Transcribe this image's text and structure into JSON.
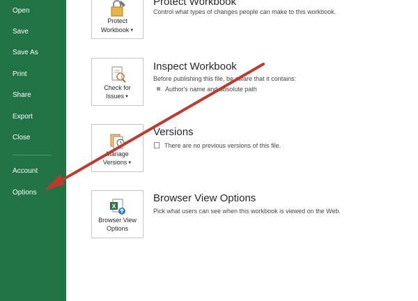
{
  "sidebar": {
    "items": [
      {
        "label": "Open"
      },
      {
        "label": "Save"
      },
      {
        "label": "Save As"
      },
      {
        "label": "Print"
      },
      {
        "label": "Share"
      },
      {
        "label": "Export"
      },
      {
        "label": "Close"
      },
      {
        "label": "Account"
      },
      {
        "label": "Options"
      }
    ]
  },
  "sections": {
    "protect": {
      "button_line1": "Protect",
      "button_line2": "Workbook",
      "title": "Protect Workbook",
      "description": "Control what types of changes people can make to this workbook."
    },
    "inspect": {
      "button_line1": "Check for",
      "button_line2": "Issues",
      "title": "Inspect Workbook",
      "description": "Before publishing this file, be aware that it contains:",
      "bullet": "Author's name and absolute path"
    },
    "versions": {
      "button_line1": "Manage",
      "button_line2": "Versions",
      "title": "Versions",
      "description": "There are no previous versions of this file."
    },
    "browser": {
      "button_line1": "Browser View",
      "button_line2": "Options",
      "title": "Browser View Options",
      "description": "Pick what users can see when this workbook is viewed on the Web."
    }
  },
  "colors": {
    "sidebar": "#217346",
    "arrow": "#c0392b"
  }
}
